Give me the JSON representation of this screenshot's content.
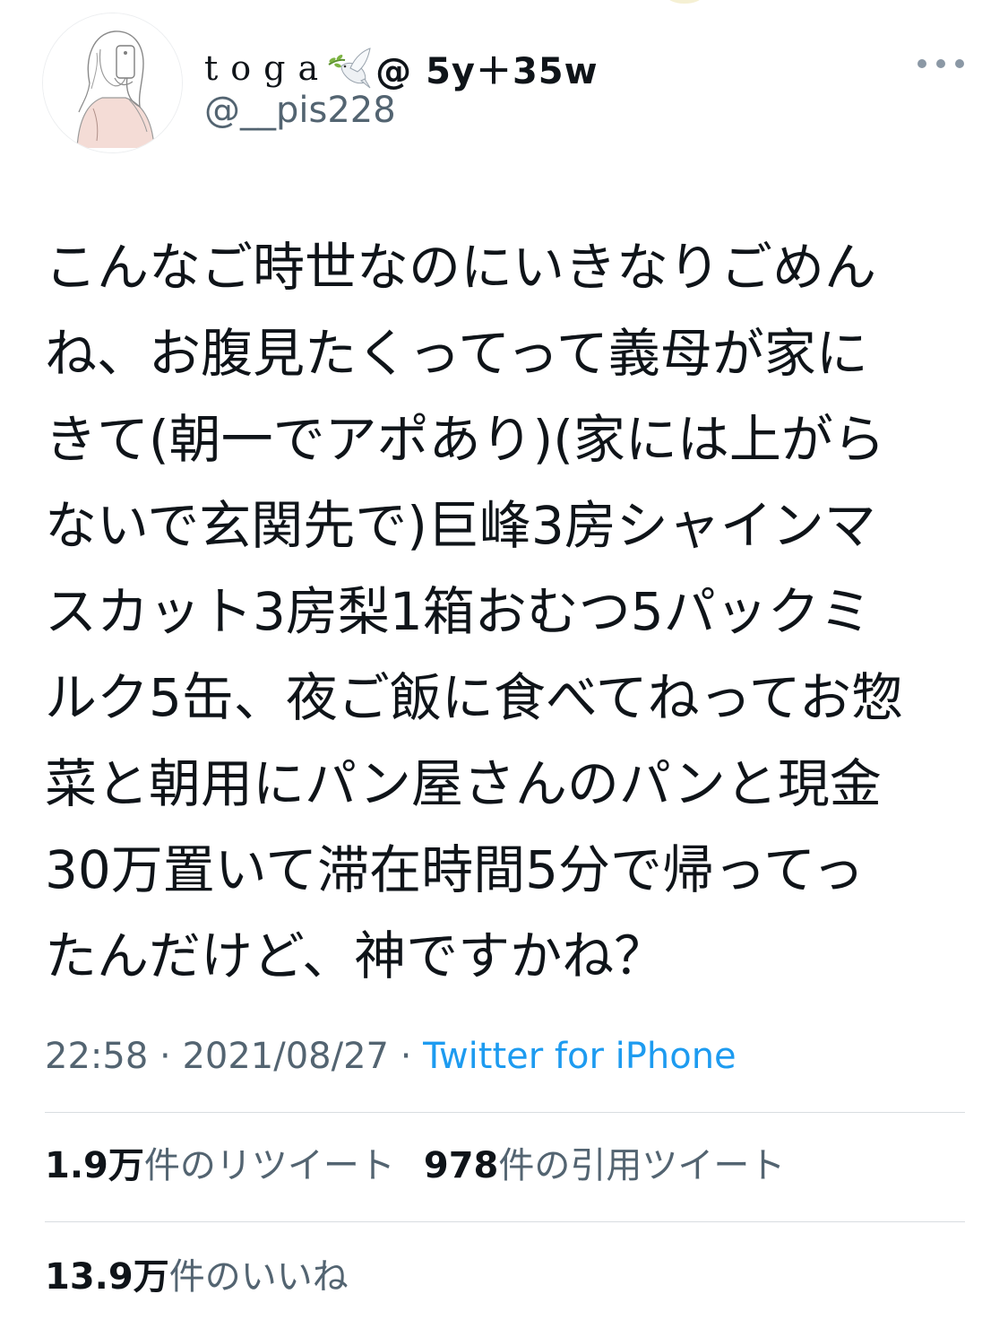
{
  "tweet": {
    "display_name": {
      "name": "toga",
      "suffix": "@ 5y＋35w"
    },
    "handle": "@__pis228",
    "body_lines": [
      "こんなご時世なのにいきなりごめん",
      "ね、お腹見たくってって義母が家に",
      "きて(朝一でアポあり)(家には上がら",
      "ないで玄関先で)巨峰3房シャインマ",
      "スカット3房梨1箱おむつ5パックミ",
      "ルク5缶、夜ご飯に食べてねってお惣",
      "菜と朝用にパン屋さんのパンと現金",
      "30万置いて滞在時間5分で帰ってっ",
      "たんだけど、神ですかね？"
    ],
    "time": "22:58",
    "date": "2021/08/27",
    "separator": " · ",
    "source": "Twitter for iPhone"
  },
  "stats": {
    "retweets_value": "1.9万",
    "retweets_label": "件のリツイート",
    "quotes_value": "978",
    "quotes_label": "件の引用ツイート",
    "likes_value": "13.9万",
    "likes_label": "件のいいね"
  },
  "icons": {
    "avatar": "avatar-illustration",
    "name_emoji": "dove-icon",
    "more": "more-options-icon"
  },
  "colors": {
    "text_primary": "#0f1419",
    "text_secondary": "#536471",
    "link": "#1d9bf0",
    "divider": "#d9dde1"
  }
}
